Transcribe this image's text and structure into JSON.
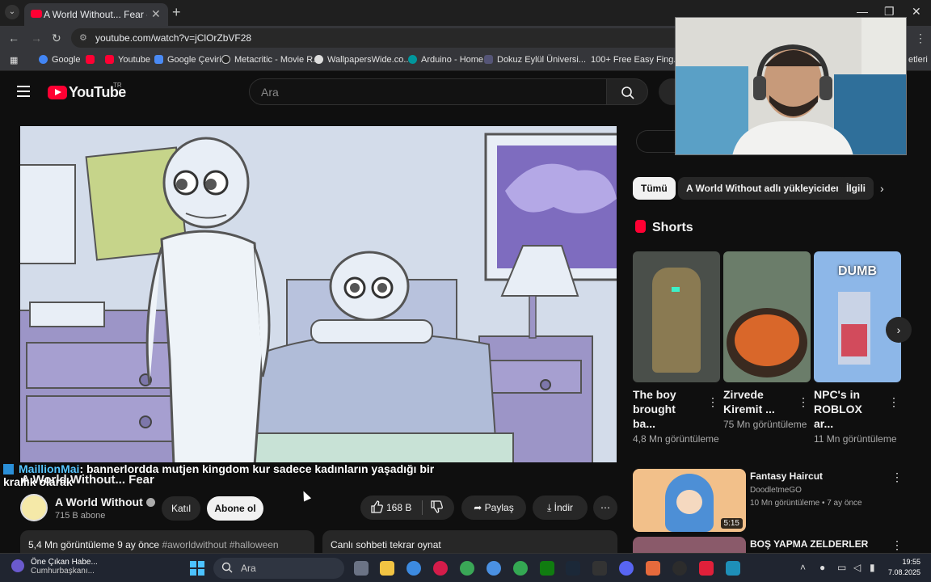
{
  "browser": {
    "tab_title": "A World Without... Fear - Yo",
    "url": "youtube.com/watch?v=jClOrZbVF28",
    "bookmarks": [
      "Google",
      "",
      "Youtube",
      "Google Çeviri",
      "Metacritic - Movie R...",
      "WallpapersWide.co...",
      "Arduino - Home",
      "Dokuz Eylül Üniversi...",
      "100+ Free Easy Fing...",
      "etleri"
    ]
  },
  "youtube": {
    "logo_text": "YouTube",
    "region": "TR",
    "search_placeholder": "Ara"
  },
  "overlay": {
    "chat_user": "MaillionMai",
    "chat_message": ": bannerlordda mutjen kingdom kur sadece kadınların yaşadığı bir krallık olarak"
  },
  "video": {
    "title": "A World Without... Fear",
    "channel": "A World Without",
    "subscribers": "715 B abone",
    "join_label": "Katıl",
    "subscribe_label": "Abone ol",
    "likes": "168 B",
    "share_label": "Paylaş",
    "download_label": "İndir",
    "views_date": "5,4 Mn görüntüleme  9 ay önce",
    "tags": "#aworldwithout #halloween",
    "live_chat_replay": "Canlı sohbeti tekrar oynat"
  },
  "sidebar": {
    "chips": [
      "Tümü",
      "A World Without adlı yükleyiciden",
      "İlgili"
    ],
    "shorts_title": "Shorts",
    "shorts": [
      {
        "title": "The boy brought ba...",
        "views": "4,8 Mn görüntüleme"
      },
      {
        "title": "Zirvede Kiremit ...",
        "views": "75 Mn görüntüleme"
      },
      {
        "title": "NPC's in ROBLOX ar...",
        "views": "11 Mn görüntüleme",
        "thumb_text": "DUMB"
      }
    ],
    "related": [
      {
        "title": "Fantasy Haircut",
        "channel": "DoodletmeGO",
        "meta": "10 Mn görüntüleme • 7 ay önce",
        "duration": "5:15"
      },
      {
        "title": "BOŞ YAPMA ZELDERLER",
        "channel": "",
        "meta": "",
        "duration": ""
      }
    ]
  },
  "taskbar": {
    "news_title": "Öne Çıkan Habe...",
    "news_sub": "Cumhurbaşkanı...",
    "search_label": "Ara",
    "time": "19:55",
    "date": "7.08.2025"
  }
}
